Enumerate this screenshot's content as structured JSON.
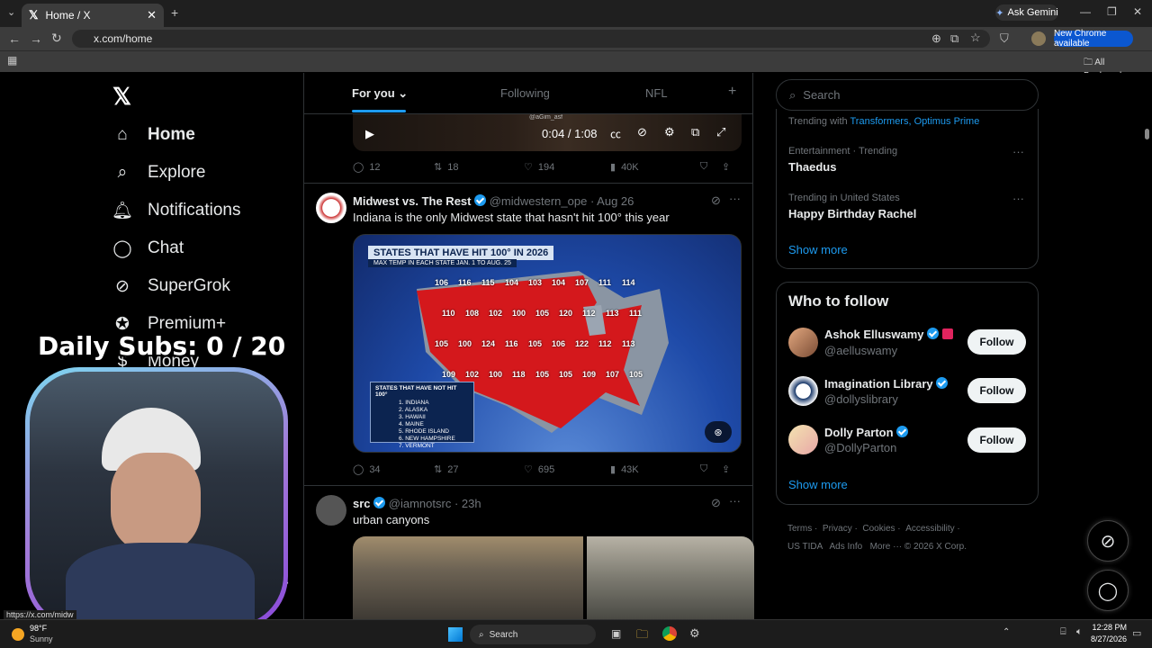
{
  "browser": {
    "tab_title": "Home / X",
    "url": "x.com/home",
    "ask_gemini": "Ask Gemini",
    "new_chrome": "New Chrome available",
    "all_bookmarks": "All Bookmarks",
    "status_url": "https://x.com/midw"
  },
  "sidebar": {
    "items": [
      {
        "label": "Home"
      },
      {
        "label": "Explore"
      },
      {
        "label": "Notifications"
      },
      {
        "label": "Chat"
      },
      {
        "label": "SuperGrok"
      },
      {
        "label": "Premium+"
      },
      {
        "label": "Money"
      }
    ]
  },
  "feed": {
    "tabs": [
      "For you",
      "Following",
      "NFL"
    ],
    "video": {
      "time": "0:04 / 1:08",
      "watermark": "@aGim_asf"
    },
    "tweet0_actions": {
      "replies": "12",
      "reposts": "18",
      "likes": "194",
      "views": "40K"
    },
    "tweet1": {
      "name": "Midwest vs. The Rest",
      "handle": "@midwestern_ope",
      "date": "· Aug 26",
      "text": "Indiana is the only Midwest state that hasn't hit 100° this year",
      "actions": {
        "replies": "34",
        "reposts": "27",
        "likes": "695",
        "views": "43K"
      },
      "map": {
        "title": "STATES THAT HAVE HIT 100° IN 2026",
        "subtitle": "MAX TEMP IN EACH STATE JAN. 1 TO AUG. 25",
        "legend_title": "STATES THAT HAVE NOT HIT 100°",
        "legend_items": [
          "1. INDIANA",
          "2. ALASKA",
          "3. HAWAII",
          "4. MAINE",
          "5. RHODE ISLAND",
          "6. NEW HAMPSHIRE",
          "7. VERMONT"
        ],
        "temps": [
          "106",
          "116",
          "115",
          "104",
          "103",
          "104",
          "107",
          "111",
          "114",
          "110",
          "108",
          "102",
          "100",
          "105",
          "120",
          "112",
          "113",
          "111",
          "105",
          "100",
          "124",
          "116",
          "105",
          "106",
          "122",
          "112",
          "113",
          "109",
          "102",
          "100",
          "118",
          "105",
          "105",
          "109",
          "107",
          "105"
        ]
      }
    },
    "tweet2": {
      "name": "src",
      "handle": "@iamnotsrc",
      "date": "· 23h",
      "text": "urban canyons"
    }
  },
  "right": {
    "search_placeholder": "Search",
    "trending_with_label": "Trending with",
    "trending_with_value": "Transformers, Optimus Prime",
    "trends": [
      {
        "meta": "Entertainment · Trending",
        "title": "Thaedus"
      },
      {
        "meta": "Trending in United States",
        "title": "Happy Birthday Rachel"
      }
    ],
    "show_more": "Show more",
    "who_to_follow": "Who to follow",
    "follow": [
      {
        "name": "Ashok Elluswamy",
        "handle": "@aelluswamy",
        "btn": "Follow"
      },
      {
        "name": "Imagination Library",
        "handle": "@dollyslibrary",
        "btn": "Follow"
      },
      {
        "name": "Dolly Parton",
        "handle": "@DollyParton",
        "btn": "Follow"
      }
    ],
    "show_more2": "Show more",
    "footer": [
      "Terms",
      "Privacy",
      "Cookies",
      "Accessibility",
      "US TIDA",
      "Ads Info",
      "More ···",
      "© 2026 X Corp."
    ]
  },
  "overlay": {
    "subs": "Daily Subs: 0 / 20"
  },
  "taskbar": {
    "temp": "98°F",
    "weather": "Sunny",
    "search": "Search",
    "time": "12:28 PM",
    "date": "8/27/2026"
  },
  "colors": {
    "accent": "#1d9bf0",
    "background": "#000000",
    "border": "#2f3336"
  }
}
